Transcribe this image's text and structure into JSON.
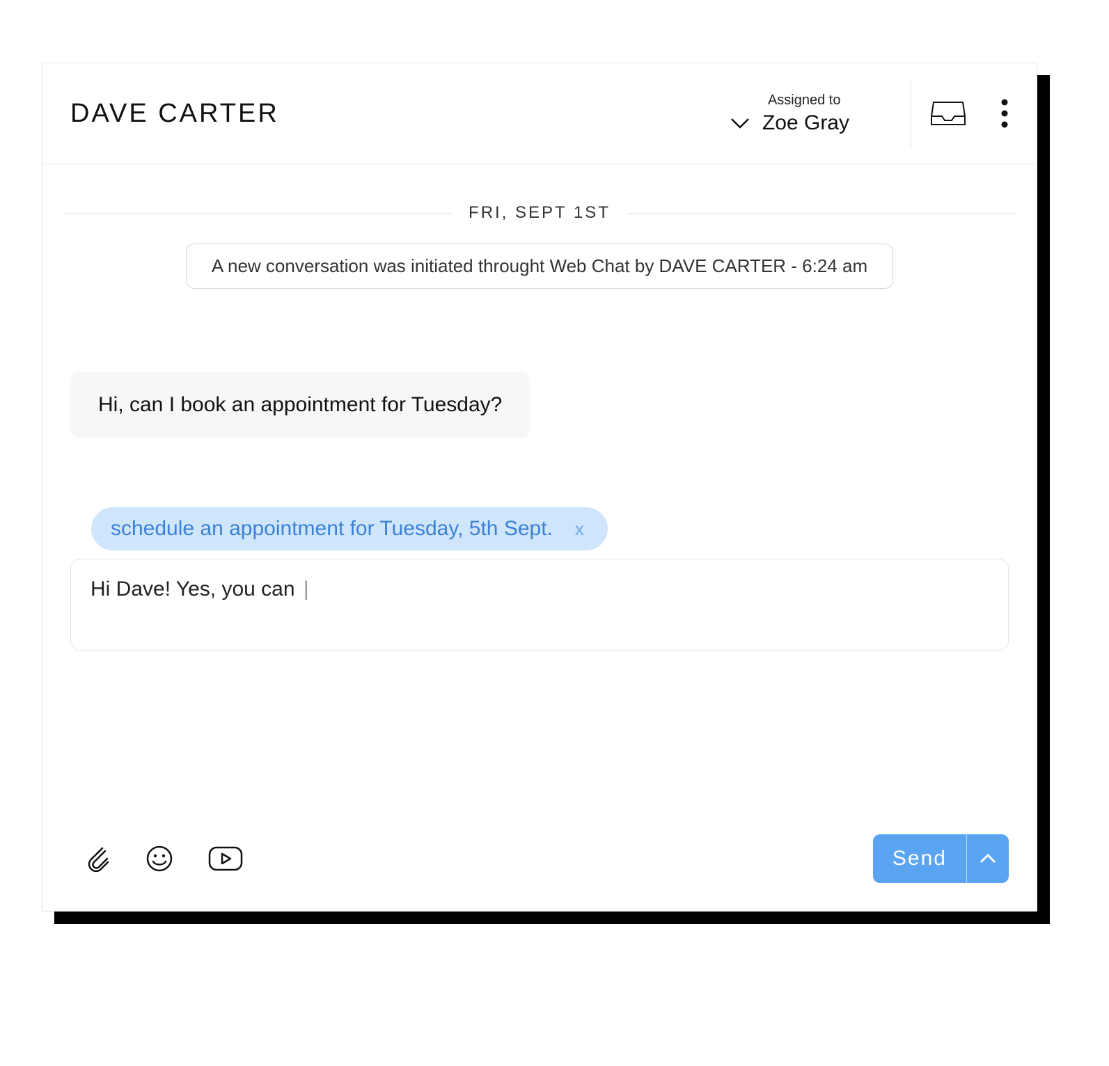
{
  "header": {
    "customer_name": "DAVE CARTER",
    "assigned_label": "Assigned to",
    "assignee": "Zoe Gray"
  },
  "date_separator": "FRI, SEPT 1ST",
  "system_note": "A new conversation was initiated throught Web Chat by DAVE CARTER - 6:24 am",
  "messages": {
    "incoming_1": "Hi, can I book an appointment for Tuesday?"
  },
  "suggestion": {
    "text": "schedule an appointment for Tuesday, 5th Sept.",
    "close": "x"
  },
  "compose": {
    "value": "Hi Dave! Yes, you can ",
    "cursor": "|"
  },
  "send": {
    "label": "Send"
  }
}
